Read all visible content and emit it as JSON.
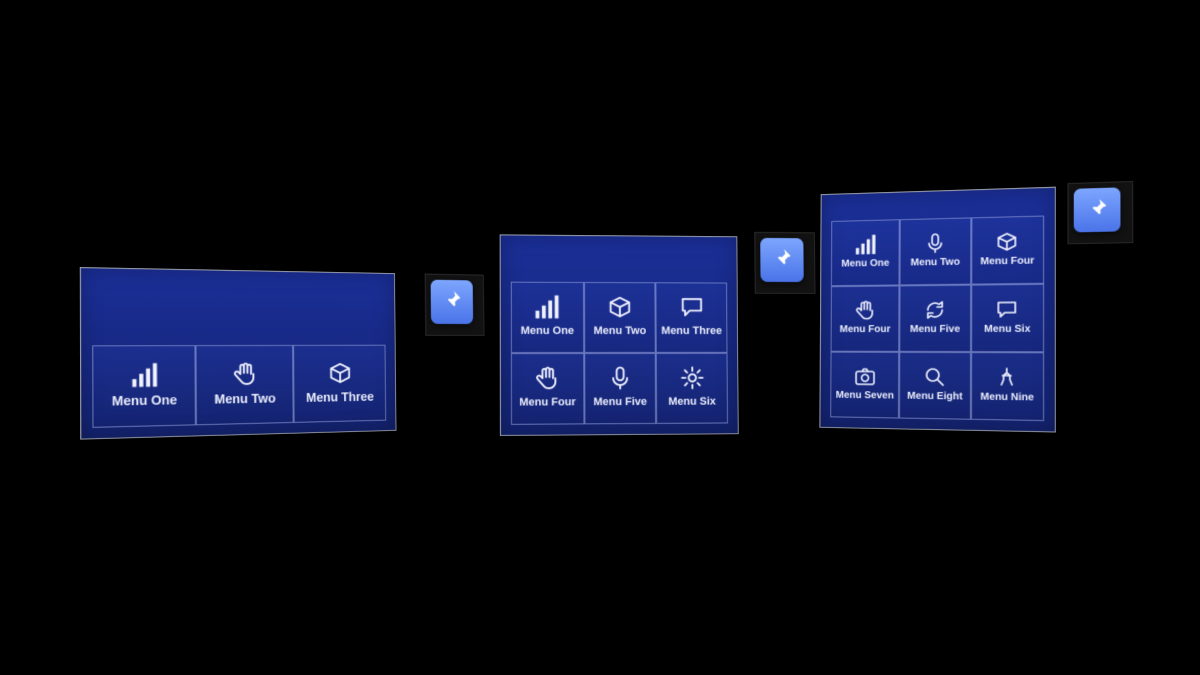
{
  "panels": {
    "a": {
      "items": [
        {
          "label": "Menu One",
          "icon": "bars"
        },
        {
          "label": "Menu Two",
          "icon": "hand"
        },
        {
          "label": "Menu Three",
          "icon": "cube"
        }
      ],
      "pin": {
        "icon": "pin"
      }
    },
    "b": {
      "items": [
        {
          "label": "Menu One",
          "icon": "bars"
        },
        {
          "label": "Menu Two",
          "icon": "cube"
        },
        {
          "label": "Menu Three",
          "icon": "chat"
        },
        {
          "label": "Menu Four",
          "icon": "hand"
        },
        {
          "label": "Menu Five",
          "icon": "mic"
        },
        {
          "label": "Menu Six",
          "icon": "gear"
        }
      ],
      "pin": {
        "icon": "pin"
      }
    },
    "c": {
      "items": [
        {
          "label": "Menu One",
          "icon": "bars"
        },
        {
          "label": "Menu Two",
          "icon": "mic"
        },
        {
          "label": "Menu Four",
          "icon": "cube"
        },
        {
          "label": "Menu Four",
          "icon": "hand"
        },
        {
          "label": "Menu Five",
          "icon": "refresh"
        },
        {
          "label": "Menu Six",
          "icon": "chat"
        },
        {
          "label": "Menu Seven",
          "icon": "camera"
        },
        {
          "label": "Menu Eight",
          "icon": "search"
        },
        {
          "label": "Menu Nine",
          "icon": "skeleton"
        }
      ],
      "pin": {
        "icon": "pin"
      }
    }
  },
  "colors": {
    "panel_bg_top": "#1b2f98",
    "panel_bg_bottom": "#142370",
    "panel_border": "#9ea2ab",
    "tile_border": "rgba(200,210,255,.45)",
    "pin_top": "#7da6ff",
    "pin_bottom": "#4a74e8"
  }
}
